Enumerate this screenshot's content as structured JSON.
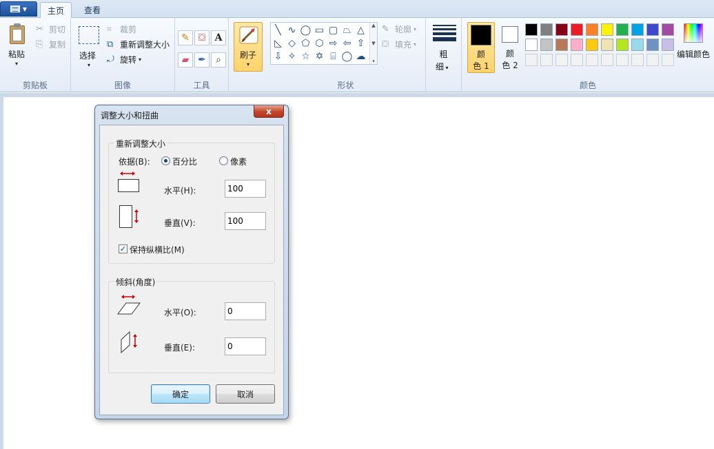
{
  "tabs": {
    "home": "主页",
    "view": "查看"
  },
  "clipboard": {
    "paste": "粘贴",
    "cut": "剪切",
    "copy": "复制",
    "group": "剪贴板"
  },
  "image": {
    "select": "选择",
    "crop": "裁剪",
    "resize": "重新调整大小",
    "rotate": "旋转",
    "group": "图像"
  },
  "tools": {
    "group": "工具",
    "text_glyph": "A"
  },
  "brushes": {
    "label": "刷子"
  },
  "shapes": {
    "outline": "轮廓",
    "fill": "填充",
    "group": "形状"
  },
  "size": {
    "label_1": "粗",
    "label_2": "细"
  },
  "colors": {
    "color1_label_1": "颜",
    "color1_label_2": "色 1",
    "color2_label_1": "颜",
    "color2_label_2": "色 2",
    "edit": "编辑颜色",
    "group": "颜色",
    "color1": "#000000",
    "color2": "#ffffff",
    "palette_row1": [
      "#000000",
      "#7f7f7f",
      "#880015",
      "#ed1c24",
      "#ff7f27",
      "#fff200",
      "#22b14c",
      "#00a2e8",
      "#3f48cc",
      "#a349a4"
    ],
    "palette_row2": [
      "#ffffff",
      "#c3c3c3",
      "#b97a57",
      "#ffaec9",
      "#ffc90e",
      "#efe4b0",
      "#b5e61d",
      "#99d9ea",
      "#7092be",
      "#c8bfe7"
    ],
    "palette_row3": [
      "#f2f2f2",
      "#f2f2f2",
      "#f2f2f2",
      "#f2f2f2",
      "#f2f2f2",
      "#f2f2f2",
      "#f2f2f2",
      "#f2f2f2",
      "#f2f2f2",
      "#f2f2f2"
    ]
  },
  "dialog": {
    "title": "调整大小和扭曲",
    "close": "x",
    "resize": {
      "legend": "重新调整大小",
      "by_label": "依据(B):",
      "percent": "百分比",
      "pixels": "像素",
      "selected": "percent",
      "horizontal_label": "水平(H):",
      "horizontal_value": "100",
      "vertical_label": "垂直(V):",
      "vertical_value": "100",
      "keep_ratio": "保持纵横比(M)",
      "keep_ratio_checked": true
    },
    "skew": {
      "legend": "倾斜(角度)",
      "horizontal_label": "水平(O):",
      "horizontal_value": "0",
      "vertical_label": "垂直(E):",
      "vertical_value": "0"
    },
    "ok": "确定",
    "cancel": "取消"
  }
}
